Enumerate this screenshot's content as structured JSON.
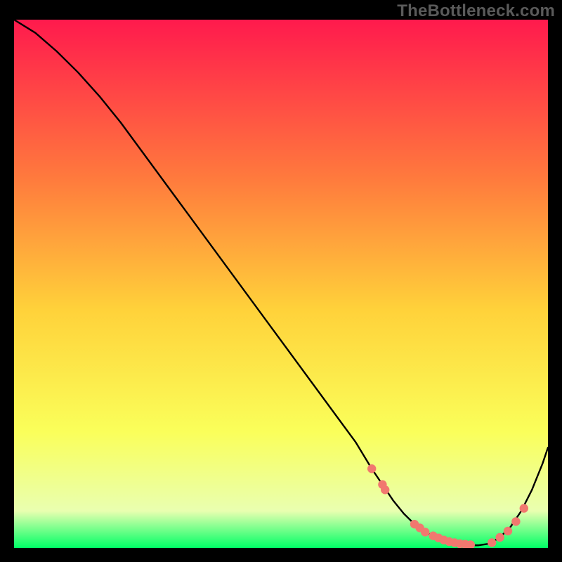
{
  "watermark": "TheBottleneck.com",
  "colors": {
    "frame": "#000000",
    "line": "#000000",
    "marker": "#f1786f",
    "watermark": "#5a5a5a",
    "grad_top": "#ff1a4d",
    "grad_upper_mid": "#ff7a3d",
    "grad_mid": "#ffd23a",
    "grad_lower_mid": "#faff5a",
    "grad_near_bottom": "#e9ffb0",
    "grad_bottom": "#00ff66"
  },
  "chart_data": {
    "type": "line",
    "title": "",
    "xlabel": "",
    "ylabel": "",
    "xlim": [
      0,
      100
    ],
    "ylim": [
      0,
      100
    ],
    "series": [
      {
        "name": "bottleneck-curve",
        "x": [
          0,
          4,
          8,
          12,
          16,
          20,
          24,
          28,
          32,
          36,
          40,
          44,
          48,
          52,
          56,
          60,
          64,
          67,
          69,
          71,
          73,
          75,
          77,
          79,
          81,
          83,
          85,
          87,
          89,
          91,
          93,
          95,
          97,
          99,
          100
        ],
        "y": [
          100,
          97.5,
          94,
          90,
          85.5,
          80.5,
          75,
          69.5,
          64,
          58.5,
          53,
          47.5,
          42,
          36.5,
          31,
          25.5,
          20,
          15,
          12,
          9,
          6.5,
          4.5,
          3,
          2,
          1.3,
          0.8,
          0.5,
          0.5,
          0.8,
          2,
          4,
          7,
          11,
          16,
          19
        ]
      }
    ],
    "markers": {
      "name": "highlight-points",
      "x": [
        67,
        69,
        69.5,
        75,
        76,
        77,
        78.5,
        79.5,
        80.5,
        81.5,
        82.5,
        83.5,
        84.5,
        85.5,
        89.5,
        91,
        92.5,
        94,
        95.5
      ],
      "y": [
        15,
        12,
        11,
        4.5,
        3.8,
        3,
        2.3,
        1.9,
        1.5,
        1.2,
        1,
        0.8,
        0.7,
        0.6,
        1,
        2,
        3.2,
        5,
        7.5
      ]
    }
  }
}
